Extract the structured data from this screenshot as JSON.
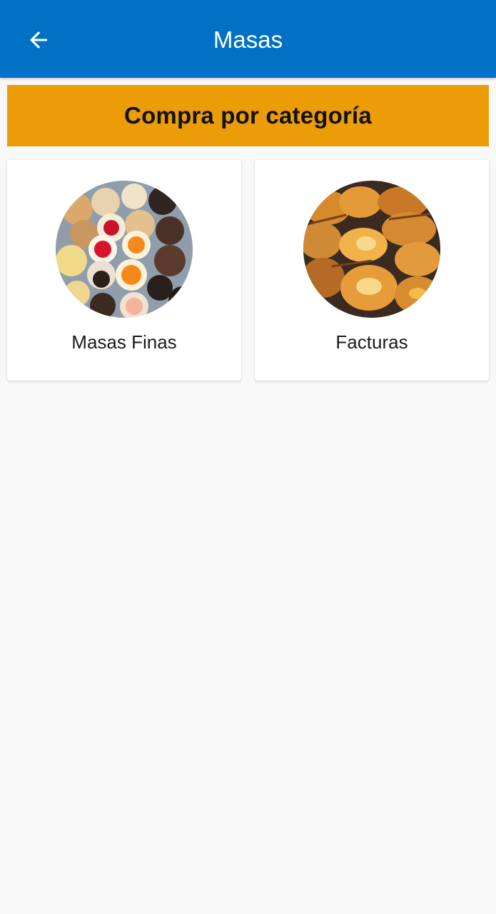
{
  "appbar": {
    "title": "Masas",
    "back_icon": "arrow-left-icon",
    "background": "#0171c5"
  },
  "banner": {
    "text": "Compra por categoría",
    "background": "#eb9c06"
  },
  "categories": [
    {
      "label": "Masas Finas",
      "image": "masas-finas-photo"
    },
    {
      "label": "Facturas",
      "image": "facturas-photo"
    }
  ]
}
